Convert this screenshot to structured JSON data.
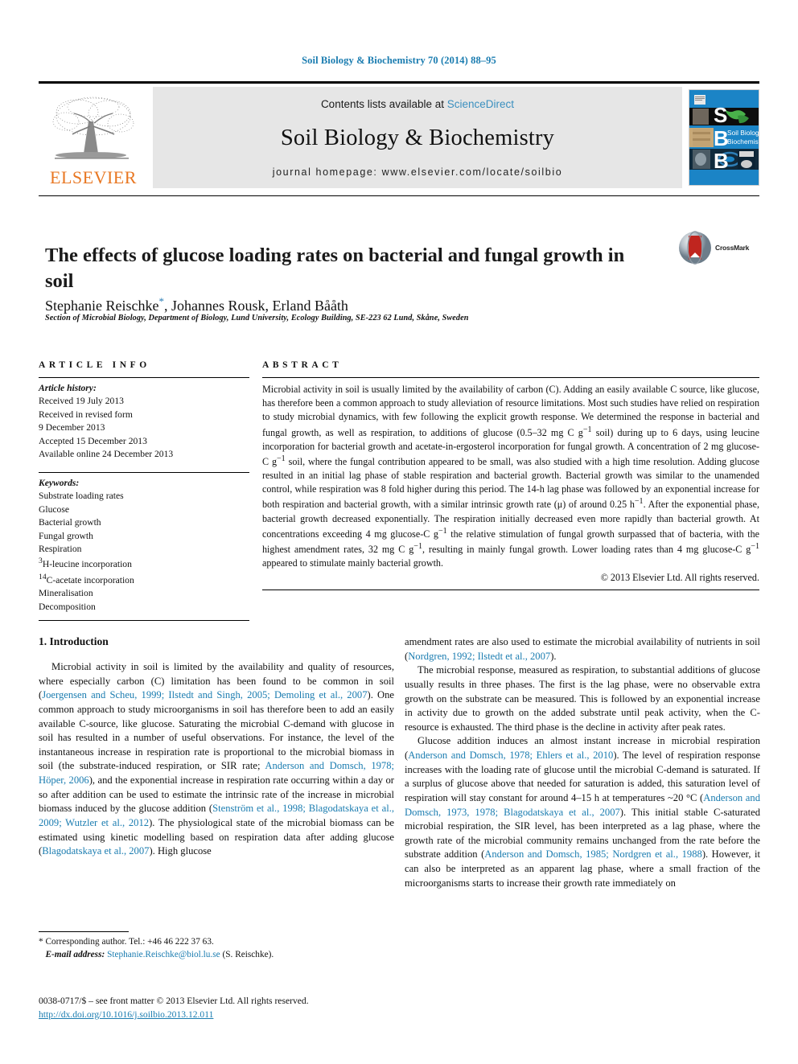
{
  "running_head": "Soil Biology & Biochemistry 70 (2014) 88–95",
  "masthead": {
    "publisher_name": "ELSEVIER",
    "contents_prefix": "Contents lists available at ",
    "contents_link": "ScienceDirect",
    "journal_title": "Soil Biology & Biochemistry",
    "homepage_line": "journal homepage: www.elsevier.com/locate/soilbio",
    "cover_letters": [
      "S",
      "B",
      "B"
    ],
    "cover_title_line1": "Soil Biology &",
    "cover_title_line2": "Biochemistry"
  },
  "article": {
    "title": "The effects of glucose loading rates on bacterial and fungal growth in soil",
    "authors": "Stephanie Reischke, Johannes Rousk, Erland Bååth",
    "author_1": "Stephanie Reischke",
    "author_rest": ", Johannes Rousk, Erland Bååth",
    "corresponding_marker": "*",
    "affiliation": "Section of Microbial Biology, Department of Biology, Lund University, Ecology Building, SE-223 62 Lund, Skåne, Sweden",
    "crossmark_label": "CrossMark"
  },
  "article_info": {
    "heading": "ARTICLE INFO",
    "history_label": "Article history:",
    "history": [
      "Received 19 July 2013",
      "Received in revised form",
      "9 December 2013",
      "Accepted 15 December 2013",
      "Available online 24 December 2013"
    ],
    "keywords_label": "Keywords:",
    "keywords": [
      "Substrate loading rates",
      "Glucose",
      "Bacterial growth",
      "Fungal growth",
      "Respiration",
      "3H-leucine incorporation",
      "14C-acetate incorporation",
      "Mineralisation",
      "Decomposition"
    ],
    "keyword_sup": {
      "leucine_sup": "3",
      "leucine_rest": "H-leucine incorporation",
      "acetate_sup": "14",
      "acetate_rest": "C-acetate incorporation"
    }
  },
  "abstract": {
    "heading": "ABSTRACT",
    "copyright": "© 2013 Elsevier Ltd. All rights reserved."
  },
  "body": {
    "section_number_title": "1. Introduction",
    "left_paragraphs": [
      "Microbial activity in soil is limited by the availability and quality of resources, where especially carbon (C) limitation has been found to be common in soil (Joergensen and Scheu, 1999; Ilstedt and Singh, 2005; Demoling et al., 2007). One common approach to study microorganisms in soil has therefore been to add an easily available C-source, like glucose. Saturating the microbial C-demand with glucose in soil has resulted in a number of useful observations. For instance, the level of the instantaneous increase in respiration rate is proportional to the microbial biomass in soil (the substrate-induced respiration, or SIR rate; Anderson and Domsch, 1978; Höper, 2006), and the exponential increase in respiration rate occurring within a day or so after addition can be used to estimate the intrinsic rate of the increase in microbial biomass induced by the glucose addition (Stenström et al., 1998; Blagodatskaya et al., 2009; Wutzler et al., 2012). The physiological state of the microbial biomass can be estimated using kinetic modelling based on respiration data after adding glucose (Blagodatskaya et al., 2007). High glucose"
    ],
    "right_paragraphs": [
      "amendment rates are also used to estimate the microbial availability of nutrients in soil (Nordgren, 1992; Ilstedt et al., 2007).",
      "The microbial response, measured as respiration, to substantial additions of glucose usually results in three phases. The first is the lag phase, were no observable extra growth on the substrate can be measured. This is followed by an exponential increase in activity due to growth on the added substrate until peak activity, when the C-resource is exhausted. The third phase is the decline in activity after peak rates.",
      "Glucose addition induces an almost instant increase in microbial respiration (Anderson and Domsch, 1978; Ehlers et al., 2010). The level of respiration response increases with the loading rate of glucose until the microbial C-demand is saturated. If a surplus of glucose above that needed for saturation is added, this saturation level of respiration will stay constant for around 4–15 h at temperatures ~20 °C (Anderson and Domsch, 1973, 1978; Blagodatskaya et al., 2007). This initial stable C-saturated microbial respiration, the SIR level, has been interpreted as a lag phase, where the growth rate of the microbial community remains unchanged from the rate before the substrate addition (Anderson and Domsch, 1985; Nordgren et al., 1988). However, it can also be interpreted as an apparent lag phase, where a small fraction of the microorganisms starts to increase their growth rate immediately on"
    ]
  },
  "footnote": {
    "corresponding": "* Corresponding author. Tel.: +46 46 222 37 63.",
    "email_label": "E-mail address:",
    "email": "Stephanie.Reischke@biol.lu.se",
    "email_suffix": "(S. Reischke)."
  },
  "footer": {
    "issn_line": "0038-0717/$ – see front matter © 2013 Elsevier Ltd. All rights reserved.",
    "doi": "http://dx.doi.org/10.1016/j.soilbio.2013.12.011"
  },
  "colors": {
    "link_blue": "#1a7cb0",
    "sciencedirect_blue": "#3a8fbf",
    "elsevier_orange": "#E87722",
    "cover_blue": "#1b84c6",
    "panel_grey": "#e6e6e6"
  }
}
